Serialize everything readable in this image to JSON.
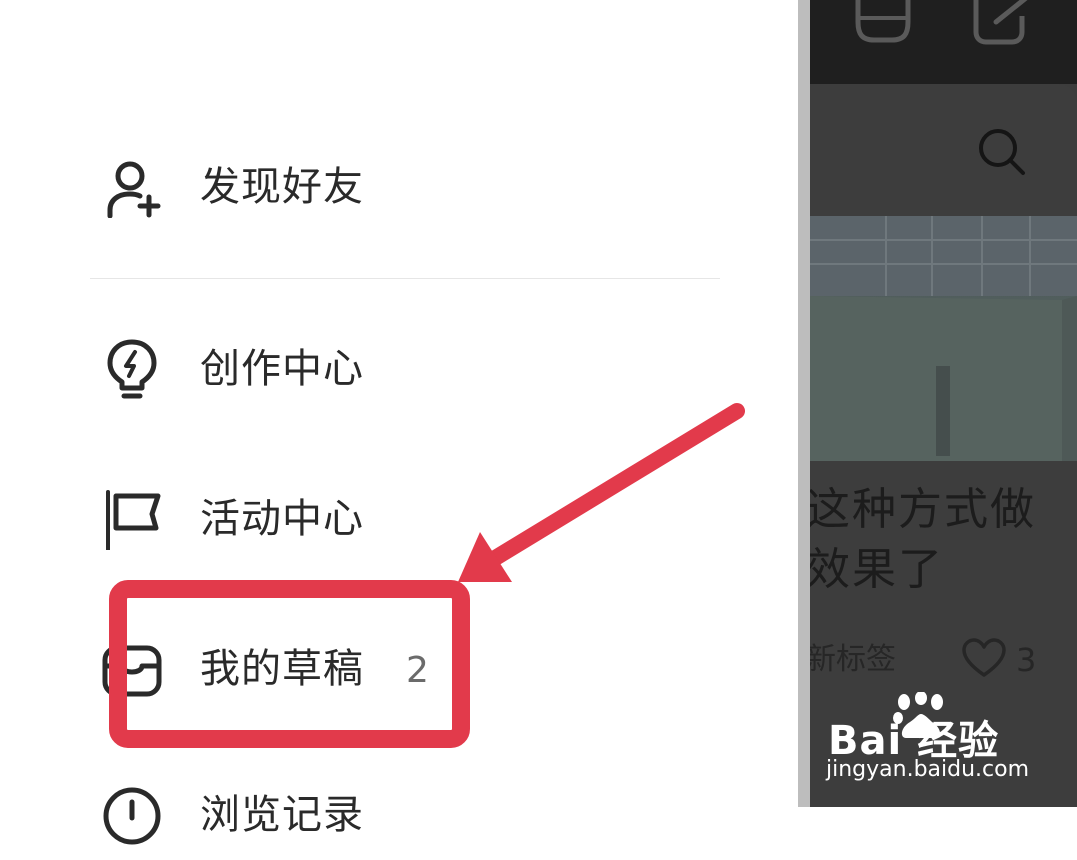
{
  "drawer": {
    "items": [
      {
        "label": "发现好友",
        "icon": "add-user-icon"
      },
      {
        "label": "创作中心",
        "icon": "lightbulb-bolt-icon"
      },
      {
        "label": "活动中心",
        "icon": "flag-icon"
      },
      {
        "label": "我的草稿",
        "icon": "inbox-icon",
        "count": "2"
      },
      {
        "label": "浏览记录",
        "icon": "clock-icon"
      }
    ]
  },
  "main": {
    "post": {
      "title": "这种方式做效果了",
      "tag": "新标签",
      "likes": "3"
    },
    "topbar_icons": [
      "scan-icon",
      "edit-icon"
    ],
    "search_icon": "search-icon"
  },
  "watermark": {
    "brand": "Bai 经验",
    "url": "jingyan.baidu.com"
  },
  "colors": {
    "annotation": "#e23a4b",
    "text": "#2a2a2a"
  }
}
